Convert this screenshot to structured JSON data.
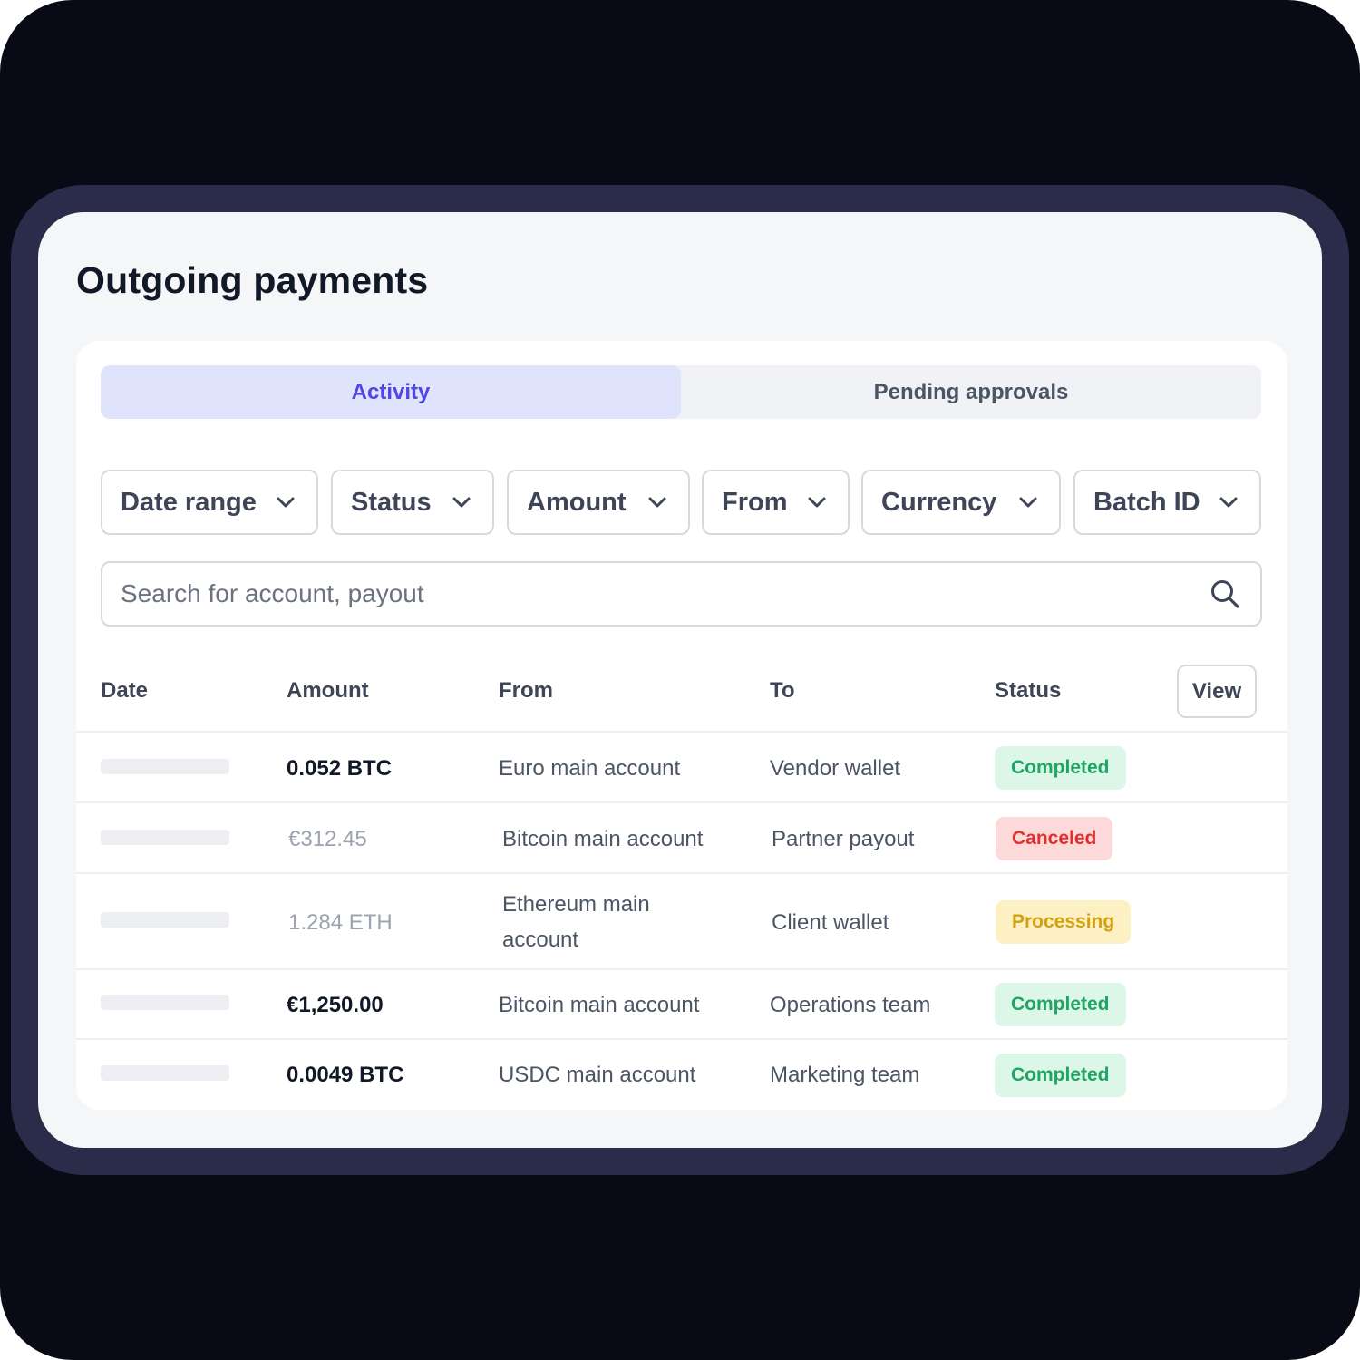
{
  "page": {
    "title": "Outgoing payments"
  },
  "tabs": [
    {
      "label": "Activity",
      "active": true
    },
    {
      "label": "Pending approvals",
      "active": false
    }
  ],
  "filters": [
    {
      "label": "Date range"
    },
    {
      "label": "Status"
    },
    {
      "label": "Amount"
    },
    {
      "label": "From"
    },
    {
      "label": "Currency"
    },
    {
      "label": "Batch ID"
    }
  ],
  "search": {
    "placeholder": "Search for account, payout",
    "value": ""
  },
  "table": {
    "columns": [
      "Date",
      "Amount",
      "From",
      "To",
      "Status"
    ],
    "view_label": "View",
    "rows": [
      {
        "amount": "0.052 BTC",
        "from": "Euro main account",
        "to": "Vendor wallet",
        "status": "Completed"
      },
      {
        "amount": "€312.45",
        "from": "Bitcoin main account",
        "to": "Partner payout",
        "status": "Canceled"
      },
      {
        "amount": "1.284 ETH",
        "from": "Ethereum main account",
        "to": "Client wallet",
        "status": "Processing"
      },
      {
        "amount": "€1,250.00",
        "from": "Bitcoin main account",
        "to": "Operations team",
        "status": "Completed"
      },
      {
        "amount": "0.0049 BTC",
        "from": "USDC main account",
        "to": "Marketing team",
        "status": "Completed"
      }
    ]
  },
  "colors": {
    "accent": "#5046e5",
    "completed": "#1fa463",
    "canceled": "#e0312f",
    "processing": "#d3a10e"
  },
  "icons": {
    "filter_chevron": "chevron-down-icon",
    "search": "search-icon"
  }
}
